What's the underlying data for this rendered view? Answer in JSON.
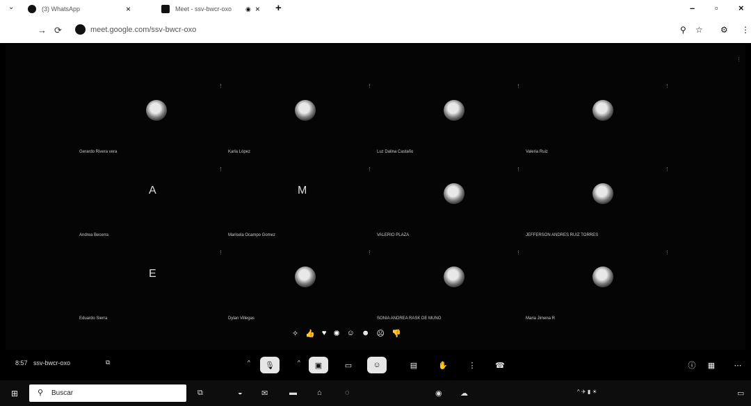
{
  "browser": {
    "tabs": [
      {
        "title": "(3) WhatsApp",
        "close": "×"
      },
      {
        "title": "Meet - ssv-bwcr-oxo",
        "close": "×"
      }
    ],
    "new_tab": "+",
    "window_controls": {
      "minimize": "–",
      "maximize": "▫",
      "close": "×"
    },
    "url": "meet.google.com/ssv-bwcr-oxo"
  },
  "participants": [
    {
      "name": "Gerardo Rivera vera",
      "initial": ""
    },
    {
      "name": "Karla López",
      "initial": ""
    },
    {
      "name": "Luz Dalina Castaño",
      "initial": ""
    },
    {
      "name": "Valeria Ruiz",
      "initial": ""
    },
    {
      "name": "Andrea Becerra",
      "initial": "A"
    },
    {
      "name": "Marisela Ocampo Gomez",
      "initial": "M"
    },
    {
      "name": "VALERIO PLAZA",
      "initial": ""
    },
    {
      "name": "JEFFERSON ANDRES RUIZ TORRES",
      "initial": ""
    },
    {
      "name": "Eduardo Sierra",
      "initial": "E"
    },
    {
      "name": "Dylan Villegas",
      "initial": ""
    },
    {
      "name": "SONIA ANDREA RASK DE MUNO",
      "initial": ""
    },
    {
      "name": "Maria Jimena R",
      "initial": ""
    }
  ],
  "meeting": {
    "time": "8:57",
    "code": "ssv-bwcr-oxo"
  },
  "taskbar": {
    "search_text": "Buscar"
  },
  "colors": {
    "stage_bg": "#050505",
    "control_light": "#e6e6e6",
    "taskbar_bg": "#0d0d0d"
  }
}
